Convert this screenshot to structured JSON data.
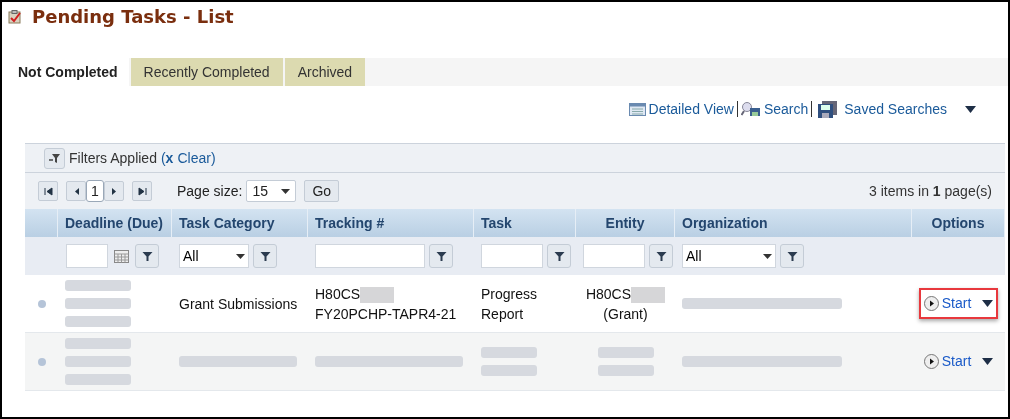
{
  "page_title": "Pending Tasks - List",
  "tabs": [
    {
      "label": "Not Completed",
      "selected": true
    },
    {
      "label": "Recently Completed",
      "selected": false
    },
    {
      "label": "Archived",
      "selected": false
    }
  ],
  "toolbar": [
    {
      "label": "Detailed View"
    },
    {
      "label": "Search"
    },
    {
      "label": "Saved Searches"
    }
  ],
  "filters_bar": {
    "label": "Filters Applied",
    "open": "(",
    "clear_mark": "x",
    "clear": "Clear",
    "close": ")"
  },
  "pager": {
    "current_page": "1",
    "page_size_label": "Page size:",
    "page_size": "15",
    "go": "Go",
    "summary": "3 items in **1** page(s)"
  },
  "table": {
    "columns": [
      {
        "label": "Deadline (Due)"
      },
      {
        "label": "Task Category",
        "filter_value": "All"
      },
      {
        "label": "Tracking #"
      },
      {
        "label": "Task"
      },
      {
        "label": "Entity"
      },
      {
        "label": "Organization",
        "filter_value": "All"
      },
      {
        "label": "Options"
      }
    ],
    "rows": [
      {
        "highlighted": true,
        "action": "Start",
        "cells": [
          [
            {
              "kind": "redacted"
            }
          ],
          [
            {
              "kind": "text",
              "text": "Grant Submissions"
            }
          ],
          [
            {
              "kind": "text",
              "text": "H80CS"
            },
            {
              "kind": "redacted"
            },
            {
              "kind": "text",
              "text": "FY20PCHP-TAPR4-21"
            }
          ],
          [
            {
              "kind": "text",
              "text": "Progress Report"
            }
          ],
          [
            {
              "kind": "text",
              "text": "H80CS"
            },
            {
              "kind": "redacted"
            },
            {
              "kind": "text",
              "text": "(Grant)"
            }
          ],
          [
            {
              "kind": "redacted"
            }
          ]
        ]
      },
      {
        "highlighted": false,
        "action": "Start",
        "cells": [
          [
            {
              "kind": "redacted"
            }
          ],
          [
            {
              "kind": "redacted"
            }
          ],
          [
            {
              "kind": "redacted"
            }
          ],
          [
            {
              "kind": "redacted"
            }
          ],
          [
            {
              "kind": "redacted"
            }
          ],
          [
            {
              "kind": "redacted"
            }
          ]
        ]
      }
    ]
  }
}
